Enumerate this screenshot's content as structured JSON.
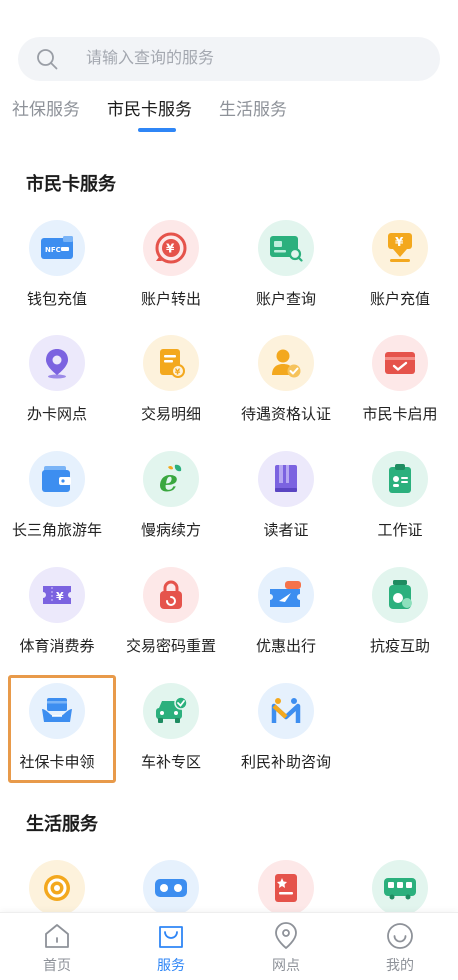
{
  "search": {
    "placeholder": "请输入查询的服务"
  },
  "tabs": [
    {
      "label": "社保服务"
    },
    {
      "label": "市民卡服务"
    },
    {
      "label": "生活服务"
    }
  ],
  "sections": {
    "citizen_card": {
      "title": "市民卡服务"
    },
    "life": {
      "title": "生活服务"
    }
  },
  "citizen_items": [
    {
      "label": "钱包充值",
      "icon": "nfc-card-icon"
    },
    {
      "label": "账户转出",
      "icon": "yuan-transfer-icon"
    },
    {
      "label": "账户查询",
      "icon": "card-search-icon"
    },
    {
      "label": "账户充值",
      "icon": "yuan-download-icon"
    },
    {
      "label": "办卡网点",
      "icon": "location-pin-icon"
    },
    {
      "label": "交易明细",
      "icon": "transaction-list-icon"
    },
    {
      "label": "待遇资格认证",
      "icon": "user-verify-icon"
    },
    {
      "label": "市民卡启用",
      "icon": "card-activate-icon"
    },
    {
      "label": "长三角旅游年",
      "icon": "wallet-icon"
    },
    {
      "label": "慢病续方",
      "icon": "e-leaf-icon"
    },
    {
      "label": "读者证",
      "icon": "book-icon"
    },
    {
      "label": "工作证",
      "icon": "clipboard-id-icon"
    },
    {
      "label": "体育消费券",
      "icon": "coupon-icon"
    },
    {
      "label": "交易密码重置",
      "icon": "lock-icon"
    },
    {
      "label": "优惠出行",
      "icon": "discount-ticket-icon"
    },
    {
      "label": "抗疫互助",
      "icon": "medicine-bottle-icon"
    },
    {
      "label": "社保卡申领",
      "icon": "card-hand-icon"
    },
    {
      "label": "车补专区",
      "icon": "car-check-icon"
    },
    {
      "label": "利民补助咨询",
      "icon": "m-logo-icon"
    }
  ],
  "life_items": [
    {
      "icon": "spiral-icon"
    },
    {
      "icon": "vr-glasses-icon"
    },
    {
      "icon": "certificate-icon"
    },
    {
      "icon": "bus-icon"
    }
  ],
  "bottom_nav": [
    {
      "label": "首页",
      "icon": "home-icon"
    },
    {
      "label": "服务",
      "icon": "bag-icon"
    },
    {
      "label": "网点",
      "icon": "location-icon"
    },
    {
      "label": "我的",
      "icon": "smile-icon"
    }
  ],
  "colors": {
    "accent": "#2f86f6",
    "highlight_border": "#e89a4a"
  }
}
